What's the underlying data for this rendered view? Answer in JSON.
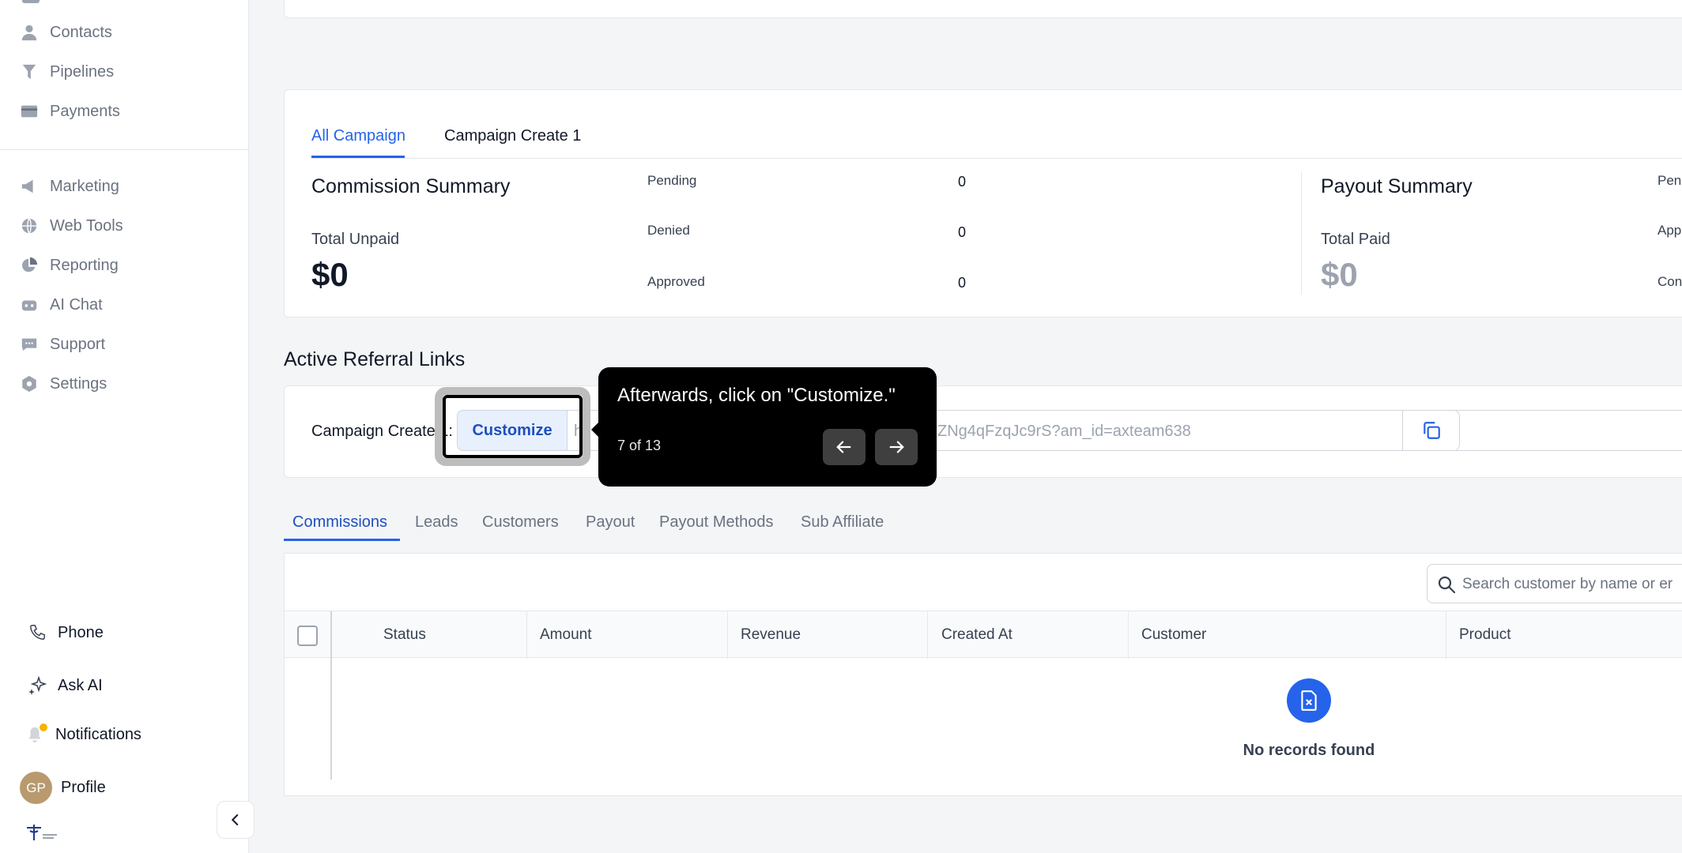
{
  "sidebar": {
    "items": [
      {
        "label": "Contacts",
        "icon": "user-icon"
      },
      {
        "label": "Pipelines",
        "icon": "funnel-icon"
      },
      {
        "label": "Payments",
        "icon": "card-icon"
      },
      {
        "label": "Marketing",
        "icon": "megaphone-icon"
      },
      {
        "label": "Web Tools",
        "icon": "globe-icon"
      },
      {
        "label": "Reporting",
        "icon": "pie-chart-icon"
      },
      {
        "label": "AI Chat",
        "icon": "robot-icon"
      },
      {
        "label": "Support",
        "icon": "chat-bubble-icon"
      },
      {
        "label": "Settings",
        "icon": "gear-icon"
      }
    ],
    "bottom": {
      "phone": "Phone",
      "ask_ai": "Ask AI",
      "notifications": "Notifications",
      "profile": "Profile",
      "avatar_initials": "GP"
    }
  },
  "campaign_tabs": [
    "All Campaign",
    "Campaign Create 1"
  ],
  "commission_summary": {
    "title": "Commission Summary",
    "total_label": "Total Unpaid",
    "total_value": "$0",
    "rows": [
      {
        "label": "Pending",
        "value": "0"
      },
      {
        "label": "Denied",
        "value": "0"
      },
      {
        "label": "Approved",
        "value": "0"
      }
    ]
  },
  "payout_summary": {
    "title": "Payout Summary",
    "total_label": "Total Paid",
    "total_value": "$0",
    "rows_partial": [
      "Pen",
      "App",
      "Con"
    ]
  },
  "referral": {
    "section_title": "Active Referral Links",
    "campaign_label": "Campaign Create 1:",
    "customize_label": "Customize",
    "link_prefix": "ht",
    "link_suffix": "ZNg4qFzqJc9rS?am_id=axteam638"
  },
  "tooltip": {
    "text": "Afterwards, click on \"Customize.\"",
    "step": "7 of 13"
  },
  "data_tabs": [
    "Commissions",
    "Leads",
    "Customers",
    "Payout",
    "Payout Methods",
    "Sub Affiliate"
  ],
  "search": {
    "placeholder": "Search customer by name or er"
  },
  "table": {
    "columns": [
      "Status",
      "Amount",
      "Revenue",
      "Created At",
      "Customer",
      "Product"
    ],
    "empty_text": "No records found"
  },
  "colors": {
    "accent": "#2563eb",
    "notification_dot": "#f5b400"
  }
}
